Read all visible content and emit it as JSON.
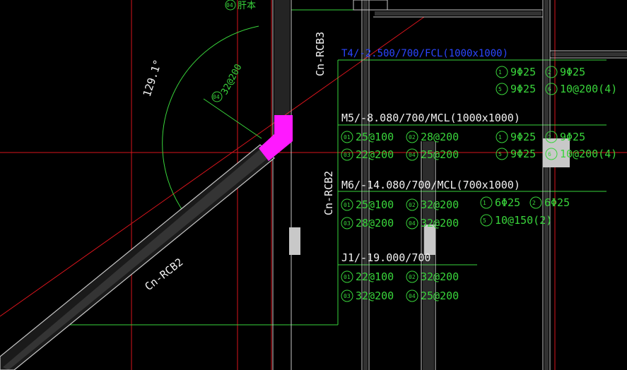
{
  "viewport": {
    "background": "#000000"
  },
  "colors": {
    "red": "#d8141c",
    "green": "#39d43b",
    "white": "#f2f2f2",
    "magenta": "#ff19ff",
    "blue": "#2b46ff",
    "gray": "#c8c8c8"
  },
  "angle_label": "129.1°",
  "beam_labels": {
    "rcb3": "Cn-RCB3",
    "rcb2_vertical": "Cn-RCB2",
    "rcb2_diagonal": "Cn-RCB2"
  },
  "dimension_label": "32@200",
  "dimension_tag": "04",
  "top_tag": "04",
  "top_partial": "肝本",
  "sections": [
    {
      "title": "T4/-2.500/700/FCL(1000x1000)",
      "left_rows": [],
      "right_rows": [
        {
          "t1": "1",
          "v1": "9Φ25",
          "t2": "2",
          "v2": "9Φ25"
        },
        {
          "t1": "5",
          "v1": "9Φ25",
          "t2": "6",
          "v2": "10@200(4)"
        }
      ]
    },
    {
      "title": "M5/-8.080/700/MCL(1000x1000)",
      "left_rows": [
        {
          "t1": "01",
          "v1": "25@100",
          "t2": "02",
          "v2": "28@200"
        },
        {
          "t1": "03",
          "v1": "22@200",
          "t2": "04",
          "v2": "25@200"
        }
      ],
      "right_rows": [
        {
          "t1": "1",
          "v1": "9Φ25",
          "t2": "2",
          "v2": "9Φ25"
        },
        {
          "t1": "5",
          "v1": "9Φ25",
          "t2": "6",
          "v2": "10@200(4)"
        }
      ]
    },
    {
      "title": "M6/-14.080/700/MCL(700x1000)",
      "left_rows": [
        {
          "t1": "01",
          "v1": "25@100",
          "t2": "02",
          "v2": "32@200"
        },
        {
          "t1": "03",
          "v1": "28@200",
          "t2": "04",
          "v2": "32@200"
        }
      ],
      "right_rows": [
        {
          "t1": "1",
          "v1": "6Φ25",
          "t2": "2",
          "v2": "6Φ25"
        },
        {
          "t1": "5",
          "v1": "10@150(2)",
          "t2": "",
          "v2": ""
        }
      ]
    },
    {
      "title": "J1/-19.000/700",
      "left_rows": [
        {
          "t1": "01",
          "v1": "22@100",
          "t2": "02",
          "v2": "32@200"
        },
        {
          "t1": "03",
          "v1": "32@200",
          "t2": "04",
          "v2": "25@200"
        }
      ],
      "right_rows": []
    }
  ]
}
